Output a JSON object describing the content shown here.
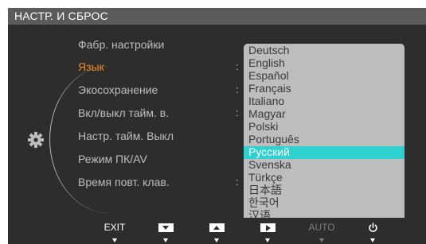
{
  "title": "НАСТР. И СБРОС",
  "menu": {
    "items": [
      {
        "label": "Фабр. настройки"
      },
      {
        "label": "Язык"
      },
      {
        "label": "Экосохранение"
      },
      {
        "label": "Вкл/выкл тайм. в."
      },
      {
        "label": "Настр. тайм. Выкл"
      },
      {
        "label": "Режим ПК/AV"
      },
      {
        "label": "Время повт. клав."
      }
    ],
    "selected_index": 1,
    "colon": ":"
  },
  "languages": {
    "options": [
      "Deutsch",
      "English",
      "Español",
      "Français",
      "Italiano",
      "Magyar",
      "Polski",
      "Português",
      "Русский",
      "Svenska",
      "Türkçe",
      "日本語",
      "한국어",
      "汉语"
    ],
    "selected": "Русский"
  },
  "buttons": {
    "exit": "EXIT",
    "down_icon": "down-arrow-icon",
    "up_icon": "up-arrow-icon",
    "enter_icon": "right-arrow-icon",
    "auto": "AUTO",
    "power_icon": "power-icon"
  },
  "colors": {
    "highlight_menu": "#f08a25",
    "highlight_option": "#2fd0d0",
    "panel_bg": "#2d2d2d",
    "title_bg": "#5b5b5b",
    "dropdown_bg": "#bdbdbd"
  }
}
